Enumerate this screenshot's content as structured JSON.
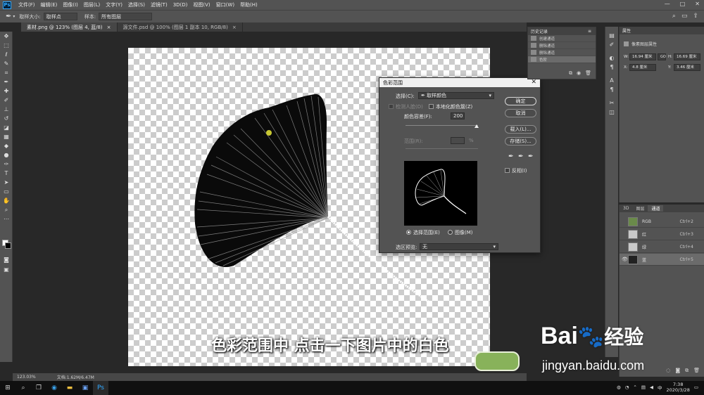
{
  "menubar": {
    "items": [
      "文件(F)",
      "编辑(E)",
      "图像(I)",
      "图层(L)",
      "文字(Y)",
      "选择(S)",
      "滤镜(T)",
      "3D(D)",
      "视图(V)",
      "窗口(W)",
      "帮助(H)"
    ],
    "controls": [
      "—",
      "□",
      "✕"
    ]
  },
  "options": {
    "sample_size_label": "取样大小:",
    "sample_size_value": "取样点",
    "sample_label": "样本:",
    "sample_value": "所有图层"
  },
  "tabs": [
    {
      "label": "素材.png @ 123% (图层 4, 蓝/8)",
      "close": "×"
    },
    {
      "label": "源文件.psd @ 100% (图层 1 副本 10, RGB/8)",
      "close": "×"
    }
  ],
  "status": {
    "zoom": "123.03%",
    "doc": "文档:1.62M/6.47M"
  },
  "subtitle": "色彩范围中 点击一下图片中的白色",
  "dialog": {
    "title": "色彩范围",
    "close": "✕",
    "select_label": "选择(C):",
    "select_value": "取样颜色",
    "detect_faces": "检测人脸(D)",
    "localized": "本地化颜色簇(Z)",
    "fuzziness_label": "颜色容差(F):",
    "fuzziness_value": "200",
    "range_label": "范围(R):",
    "range_unit": "%",
    "ok": "确定",
    "cancel": "取消",
    "load": "载入(L)...",
    "save": "存储(S)...",
    "invert": "反相(I)",
    "selection_radio": "选择范围(E)",
    "image_radio": "图像(M)",
    "preview_label": "选区预览:",
    "preview_value": "无"
  },
  "history": {
    "title": "历史记录",
    "rows": [
      "创建通道",
      "删除通道",
      "删除通道",
      "色阶"
    ]
  },
  "properties": {
    "title": "属性",
    "subtitle": "像素图层属性",
    "w_label": "W:",
    "w_value": "16.94 厘米",
    "h_label": "H:",
    "h_value": "16.69 厘米",
    "x_label": "X:",
    "x_value": "4.8 厘米",
    "y_label": "Y:",
    "y_value": "3.46 厘米",
    "link": "GO"
  },
  "channels": {
    "tabs": [
      "3D",
      "图层",
      "通道"
    ],
    "rows": [
      {
        "name": "RGB",
        "shortcut": "Ctrl+2"
      },
      {
        "name": "红",
        "shortcut": "Ctrl+3"
      },
      {
        "name": "绿",
        "shortcut": "Ctrl+4"
      },
      {
        "name": "蓝",
        "shortcut": "Ctrl+5"
      }
    ]
  },
  "taskbar": {
    "time": "7:38",
    "date": "2020/3/28",
    "ime": "中"
  },
  "watermark": {
    "brand": "Bai",
    "brand2": "经验",
    "url": "jingyan.baidu.com"
  }
}
